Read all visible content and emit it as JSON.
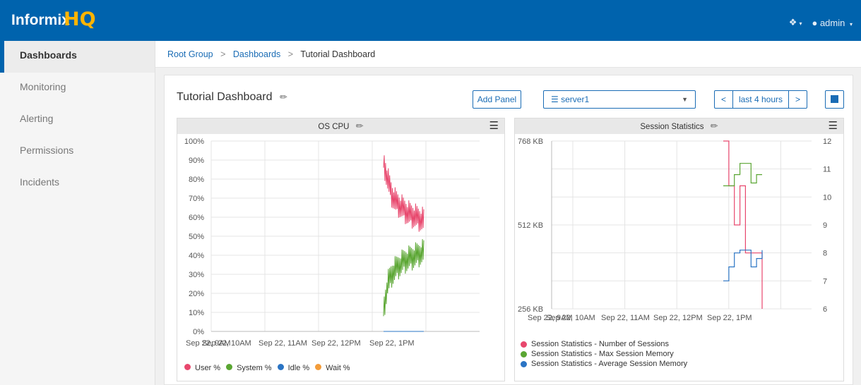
{
  "app": {
    "logo_text": "Informix",
    "logo_mark": "HQ"
  },
  "header": {
    "help_icon": "info-icon",
    "user_label": "admin"
  },
  "sidebar": {
    "items": [
      {
        "label": "Dashboards",
        "active": true
      },
      {
        "label": "Monitoring"
      },
      {
        "label": "Alerting"
      },
      {
        "label": "Permissions"
      },
      {
        "label": "Incidents"
      }
    ]
  },
  "breadcrumb": {
    "items": [
      "Root Group",
      "Dashboards",
      "Tutorial Dashboard"
    ]
  },
  "dashboard": {
    "title": "Tutorial Dashboard",
    "add_panel_label": "Add Panel",
    "server_value": "server1",
    "time_range": "last 4 hours"
  },
  "colors": {
    "brand": "#0063ad",
    "accent": "#ffb400",
    "series_red": "#e8476d",
    "series_green": "#5aa632",
    "series_blue": "#2a74c4",
    "series_orange": "#f39c3a"
  },
  "chart_data": [
    {
      "type": "line",
      "title": "OS CPU",
      "ylabel": "",
      "y_ticks": [
        "100%",
        "90%",
        "80%",
        "70%",
        "60%",
        "50%",
        "40%",
        "30%",
        "20%",
        "10%",
        "0%"
      ],
      "x_ticks": [
        "Sep 22, 9AM",
        "Sep 22, 10AM",
        "Sep 22, 11AM",
        "Sep 22, 12PM",
        "Sep 22, 1PM"
      ],
      "ylim": [
        0,
        100
      ],
      "series": [
        {
          "name": "User %",
          "color": "#e8476d",
          "values": [
            89,
            80,
            72,
            68,
            66,
            64,
            62,
            61,
            60,
            59,
            58
          ]
        },
        {
          "name": "System %",
          "color": "#5aa632",
          "values": [
            11,
            25,
            30,
            33,
            35,
            37,
            38,
            39,
            40,
            41,
            42
          ]
        },
        {
          "name": "Idle %",
          "color": "#2a74c4",
          "values": [
            0,
            0,
            0,
            0,
            0,
            0,
            0,
            0,
            0,
            0,
            0
          ]
        },
        {
          "name": "Wait %",
          "color": "#f39c3a",
          "values": []
        }
      ],
      "legend": "bottom"
    },
    {
      "type": "line",
      "title": "Session Statistics",
      "y_left_ticks": [
        "768 KB",
        "512 KB",
        "256 KB"
      ],
      "y_right_ticks": [
        "12",
        "11",
        "10",
        "9",
        "8",
        "7",
        "6"
      ],
      "x_ticks": [
        "Sep 22, 9AM",
        "Sep 22, 10AM",
        "Sep 22, 11AM",
        "Sep 22, 12PM",
        "Sep 22, 1PM"
      ],
      "series": [
        {
          "name": "Session Statistics - Number of Sessions",
          "color": "#e8476d",
          "values": [
            12,
            10.4,
            9,
            10.4,
            8,
            8,
            8,
            6
          ]
        },
        {
          "name": "Session Statistics - Max Session Memory",
          "color": "#5aa632",
          "values": [
            10.4,
            10.4,
            10.8,
            11.2,
            11.2,
            10.5,
            10.8,
            10.8
          ]
        },
        {
          "name": "Session Statistics - Average Session Memory",
          "color": "#2a74c4",
          "values": [
            7,
            7.5,
            8,
            8.1,
            8.1,
            7.5,
            7.8,
            8.1
          ]
        }
      ],
      "legend": "bottom"
    }
  ]
}
